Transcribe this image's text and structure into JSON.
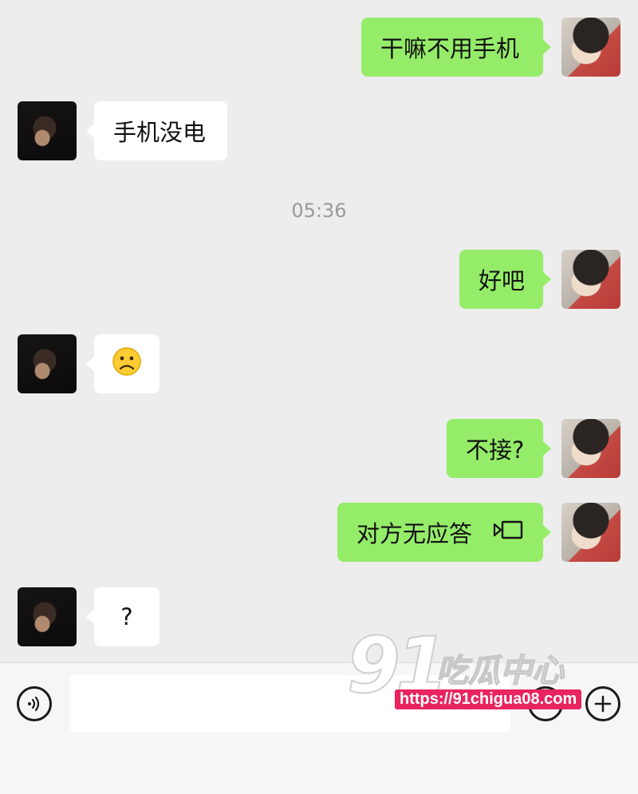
{
  "messages": [
    {
      "side": "me",
      "text": "干嘛不用手机"
    },
    {
      "side": "them",
      "text": "手机没电"
    },
    {
      "side": "system",
      "text": "05:36"
    },
    {
      "side": "me",
      "text": "好吧"
    },
    {
      "side": "them",
      "text": "☹️",
      "icon": "frowning-face-emoji"
    },
    {
      "side": "me",
      "text": "不接?"
    },
    {
      "side": "me",
      "text": "对方无应答",
      "icon": "video-call-icon"
    },
    {
      "side": "them",
      "text": "?"
    }
  ],
  "input_bar": {
    "voice_icon": "voice-input-icon",
    "text_value": "",
    "emoji_icon": "emoji-icon",
    "add_icon": "plus-icon"
  },
  "watermark": {
    "number": "91",
    "name": "吃瓜中心",
    "url": "https://91chigua08.com"
  }
}
